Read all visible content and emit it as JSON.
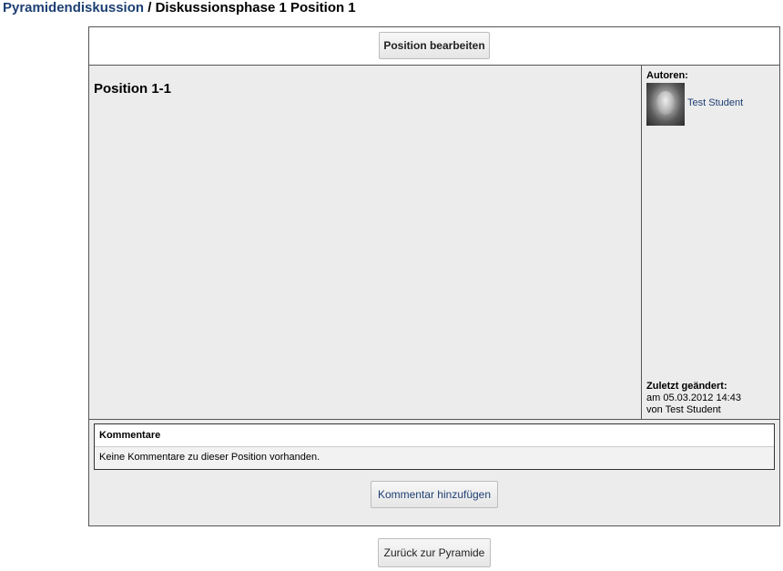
{
  "breadcrumb": {
    "parent_link": "Pyramidendiskussion",
    "separator": " / ",
    "current": "Diskussionsphase 1 Position 1"
  },
  "toolbar": {
    "edit_label": "Position bearbeiten"
  },
  "position": {
    "title": "Position 1-1"
  },
  "sidebar": {
    "authors_label": "Autoren:",
    "author_name": "Test Student",
    "last_changed_label": "Zuletzt geändert:",
    "last_changed_date": "am 05.03.2012 14:43",
    "last_changed_by": "von Test Student"
  },
  "comments": {
    "header": "Kommentare",
    "empty_text": "Keine Kommentare zu dieser Position vorhanden.",
    "add_label": "Kommentar hinzufügen"
  },
  "footer": {
    "back_label": "Zurück zur Pyramide"
  },
  "colors": {
    "link": "#1d3f72",
    "panel_bg": "#ececec",
    "border": "#555555"
  }
}
